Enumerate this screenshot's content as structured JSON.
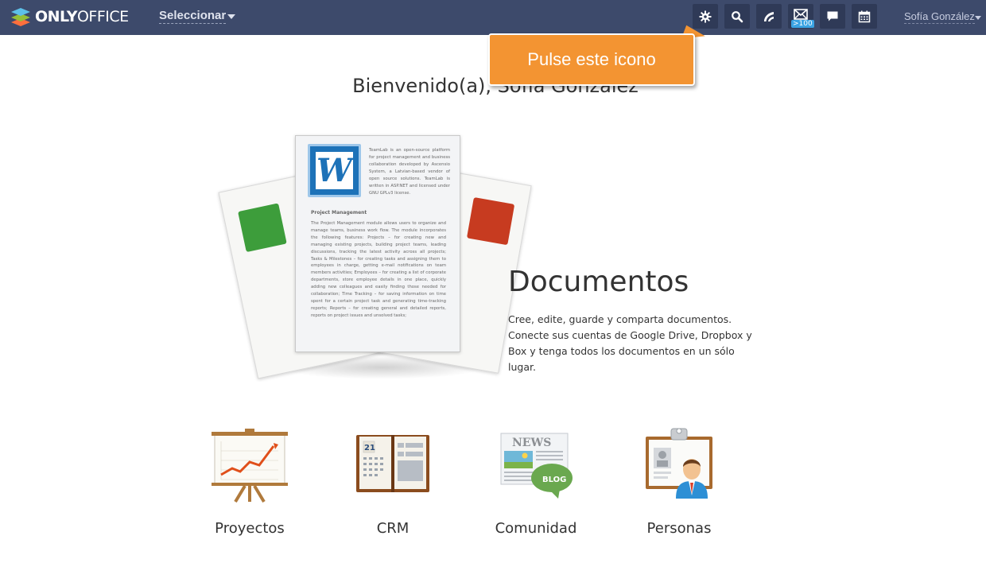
{
  "header": {
    "logo_bold": "ONLY",
    "logo_rest": "OFFICE",
    "select_menu": "Seleccionar",
    "mail_badge": ">100",
    "user_name": "Sofía González",
    "icons": [
      "settings-icon",
      "search-icon",
      "feed-icon",
      "mail-icon",
      "chat-icon",
      "calendar-icon"
    ]
  },
  "tooltip": {
    "text": "Pulse este icono"
  },
  "welcome": {
    "text": "Bienvenido(a), Sofía González"
  },
  "hero": {
    "page_text_intro": "TeamLab is an open-source platform for project management and business collaboration developed by Ascensio System, a Latvian-based vendor of open source solutions. TeamLab is written in ASP.NET and licensed under GNU GPLv3 license.",
    "page_heading": "Project Management",
    "page_body": "The Project Management module allows users to organize and manage teams, business work flow. The module incorporates the following features: Projects – for creating new and managing existing projects, building project teams, leading discussions, tracking the latest activity across all projects; Tasks & Milestones – for creating tasks and assigning them to employees in charge, getting e-mail notifications on team members activities; Employees – for creating a list of corporate departments, store employee details in one place, quickly adding new colleagues and easily finding those needed for collaboration; Time Tracking – for saving information on time spent for a certain project task and generating time-tracking reports; Reports – for creating general and detailed reports, reports on project issues and unsolved tasks;",
    "word_letter": "W",
    "title": "Documentos",
    "description": "Cree, edite, guarde y comparta documentos. Conecte sus cuentas de Google Drive, Dropbox y Box y tenga todos los documentos en un sólo lugar."
  },
  "modules": [
    {
      "label": "Proyectos",
      "icon": "projects-easel-icon"
    },
    {
      "label": "CRM",
      "icon": "crm-book-icon"
    },
    {
      "label": "Comunidad",
      "icon": "community-news-blog-icon"
    },
    {
      "label": "Personas",
      "icon": "people-clipboard-icon"
    }
  ],
  "module_texts": {
    "news": "NEWS",
    "blog": "BLOG",
    "calendar_day": "21"
  },
  "colors": {
    "topbar": "#3d4a6b",
    "tooltip": "#f39432",
    "button": "#2f3a57"
  }
}
